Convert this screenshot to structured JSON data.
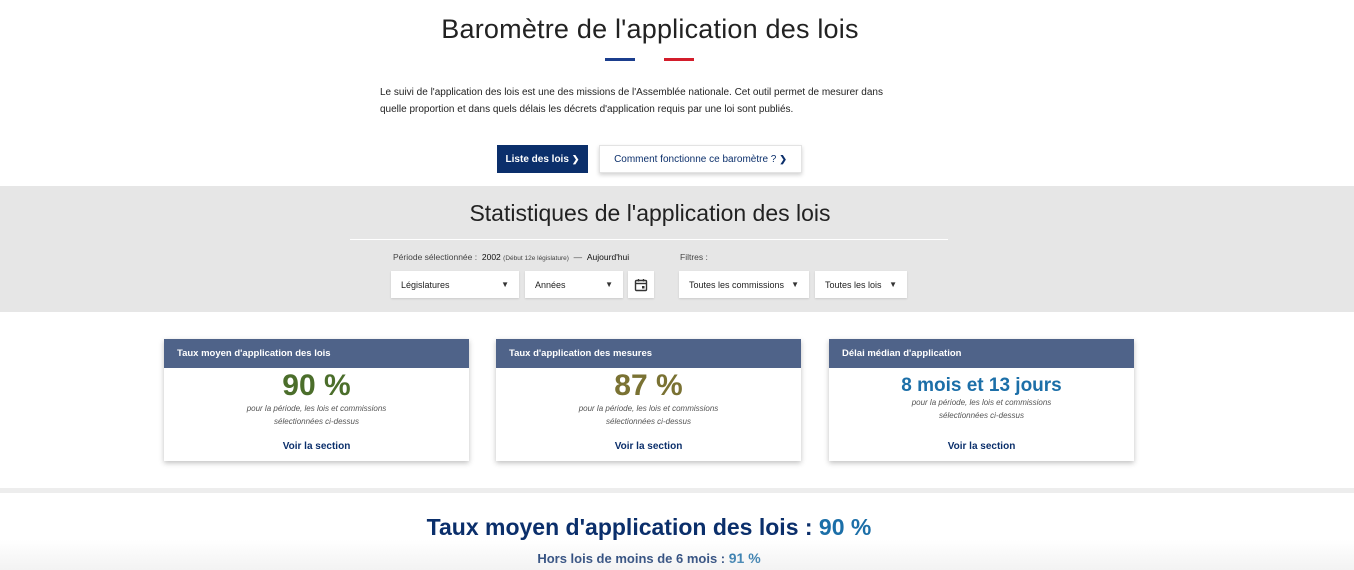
{
  "header": {
    "title": "Baromètre de l'application des lois",
    "flag_colors": [
      "#1b3e8d",
      "#ffffff",
      "#d31d2b"
    ],
    "intro": "Le suivi de l'application des lois est une des missions de l'Assemblée nationale. Cet outil permet de mesurer dans quelle proportion et dans quels délais les décrets d'application requis par une loi sont publiés."
  },
  "buttons": {
    "list_label": "Liste des lois",
    "how_label": "Comment fonctionne ce baromètre ?",
    "chevron_icon": "chevron-right-icon"
  },
  "stats": {
    "title": "Statistiques de l'application des lois",
    "periode_label": "Période sélectionnée :",
    "periode_start": "2002",
    "periode_start_note": "(Début 12e législature)",
    "periode_sep": "—",
    "periode_end": "Aujourd'hui",
    "filtres_label": "Filtres :",
    "selects": {
      "legislatures": "Législatures",
      "annees": "Années",
      "commissions": "Toutes les commissions",
      "lois": "Toutes les lois"
    },
    "calendar_icon": "calendar-icon"
  },
  "cards": [
    {
      "title": "Taux moyen d'application des lois",
      "value": "90 %",
      "value_color": "#4b6e2b",
      "description": "pour la période, les lois et commissions sélectionnées ci-dessus",
      "link": "Voir la section"
    },
    {
      "title": "Taux d'application des mesures",
      "value": "87 %",
      "value_color": "#7a7233",
      "description": "pour la période, les lois et commissions sélectionnées ci-dessus",
      "link": "Voir la section"
    },
    {
      "title": "Délai médian d'application",
      "value": "8 mois et 13 jours",
      "value_color": "#1c6fa8",
      "description": "pour la période, les lois et commissions sélectionnées ci-dessus",
      "link": "Voir la section"
    }
  ],
  "section": {
    "title": "Taux moyen d'application des lois :",
    "title_value": "90 %",
    "sub": "Hors lois de moins de 6 mois :",
    "sub_value": "91 %"
  }
}
